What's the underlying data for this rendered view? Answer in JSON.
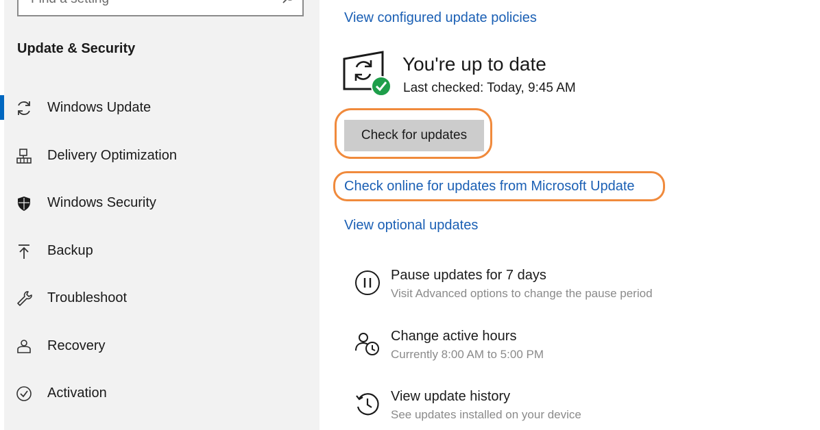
{
  "sidebar": {
    "search_placeholder": "Find a setting",
    "section_title": "Update & Security",
    "items": [
      {
        "label": "Windows Update",
        "icon": "sync-icon",
        "active": true
      },
      {
        "label": "Delivery Optimization",
        "icon": "delivery-optimization-icon"
      },
      {
        "label": "Windows Security",
        "icon": "shield-icon"
      },
      {
        "label": "Backup",
        "icon": "backup-arrow-icon"
      },
      {
        "label": "Troubleshoot",
        "icon": "wrench-icon"
      },
      {
        "label": "Recovery",
        "icon": "recovery-icon"
      },
      {
        "label": "Activation",
        "icon": "check-circle-icon"
      }
    ]
  },
  "main": {
    "policies_link": "View configured update policies",
    "status_title": "You're up to date",
    "last_checked": "Last checked: Today, 9:45 AM",
    "check_button": "Check for updates",
    "online_link": "Check online for updates from Microsoft Update",
    "optional_link": "View optional updates",
    "options": [
      {
        "title": "Pause updates for 7 days",
        "subtitle": "Visit Advanced options to change the pause period",
        "icon": "pause-icon"
      },
      {
        "title": "Change active hours",
        "subtitle": "Currently 8:00 AM to 5:00 PM",
        "icon": "active-hours-icon"
      },
      {
        "title": "View update history",
        "subtitle": "See updates installed on your device",
        "icon": "history-icon"
      }
    ]
  },
  "colors": {
    "accent": "#0067c0",
    "link": "#1a5fb4",
    "highlight": "#f08a3c",
    "success": "#1e9e4a",
    "warning_text": "#c42b1c"
  }
}
